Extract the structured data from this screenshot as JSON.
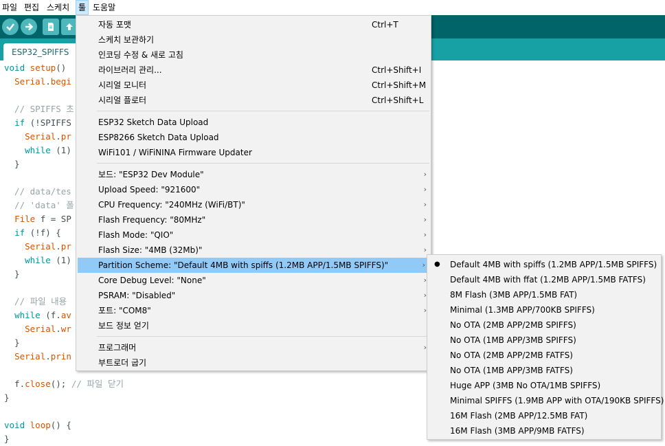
{
  "menubar": {
    "items": [
      {
        "label": "파일"
      },
      {
        "label": "편집"
      },
      {
        "label": "스케치"
      },
      {
        "label": "툴"
      },
      {
        "label": "도움말"
      }
    ]
  },
  "toolbar": {
    "buttons": [
      "verify-icon",
      "upload-icon",
      "new-icon",
      "open-icon"
    ],
    "accent": "#006468",
    "button_color": "#4db7bb"
  },
  "tabs": [
    {
      "label": "ESP32_SPIFFS"
    }
  ],
  "code": {
    "lines": [
      {
        "segments": [
          {
            "t": "void",
            "c": "kw"
          },
          {
            "t": " "
          },
          {
            "t": "setup",
            "c": "fn"
          },
          {
            "t": "()"
          }
        ]
      },
      {
        "segments": [
          {
            "t": "  "
          },
          {
            "t": "Serial",
            "c": "fn"
          },
          {
            "t": "."
          },
          {
            "t": "begi",
            "c": "fn"
          }
        ]
      },
      {
        "segments": []
      },
      {
        "segments": [
          {
            "t": "  // SPIFFS 초",
            "c": "cm"
          }
        ]
      },
      {
        "segments": [
          {
            "t": "  "
          },
          {
            "t": "if",
            "c": "kw"
          },
          {
            "t": " (!SPIFFS"
          }
        ]
      },
      {
        "segments": [
          {
            "t": "    "
          },
          {
            "t": "Serial",
            "c": "fn"
          },
          {
            "t": "."
          },
          {
            "t": "pr",
            "c": "fn"
          }
        ]
      },
      {
        "segments": [
          {
            "t": "    "
          },
          {
            "t": "while",
            "c": "kw"
          },
          {
            "t": " (1)"
          }
        ]
      },
      {
        "segments": [
          {
            "t": "  }"
          }
        ]
      },
      {
        "segments": []
      },
      {
        "segments": [
          {
            "t": "  // data/tes",
            "c": "cm"
          }
        ]
      },
      {
        "segments": [
          {
            "t": "  // 'data' 폴",
            "c": "cm"
          }
        ]
      },
      {
        "segments": [
          {
            "t": "  "
          },
          {
            "t": "File",
            "c": "fn"
          },
          {
            "t": " f = SP"
          }
        ]
      },
      {
        "segments": [
          {
            "t": "  "
          },
          {
            "t": "if",
            "c": "kw"
          },
          {
            "t": " (!f) {"
          }
        ]
      },
      {
        "segments": [
          {
            "t": "    "
          },
          {
            "t": "Serial",
            "c": "fn"
          },
          {
            "t": "."
          },
          {
            "t": "pr",
            "c": "fn"
          }
        ]
      },
      {
        "segments": [
          {
            "t": "    "
          },
          {
            "t": "while",
            "c": "kw"
          },
          {
            "t": " (1)"
          }
        ]
      },
      {
        "segments": [
          {
            "t": "  }"
          }
        ]
      },
      {
        "segments": []
      },
      {
        "segments": [
          {
            "t": "  // 파일 내용",
            "c": "cm"
          }
        ]
      },
      {
        "segments": [
          {
            "t": "  "
          },
          {
            "t": "while",
            "c": "kw"
          },
          {
            "t": " (f."
          },
          {
            "t": "av",
            "c": "fn"
          }
        ]
      },
      {
        "segments": [
          {
            "t": "    "
          },
          {
            "t": "Serial",
            "c": "fn"
          },
          {
            "t": "."
          },
          {
            "t": "wr",
            "c": "fn"
          }
        ]
      },
      {
        "segments": [
          {
            "t": "  }"
          }
        ]
      },
      {
        "segments": [
          {
            "t": "  "
          },
          {
            "t": "Serial",
            "c": "fn"
          },
          {
            "t": "."
          },
          {
            "t": "prin",
            "c": "fn"
          }
        ]
      },
      {
        "segments": []
      },
      {
        "segments": [
          {
            "t": "  f."
          },
          {
            "t": "close",
            "c": "fn"
          },
          {
            "t": "(); "
          },
          {
            "t": "// 파일 닫기",
            "c": "cm"
          }
        ]
      },
      {
        "segments": [
          {
            "t": "}"
          }
        ]
      },
      {
        "segments": []
      },
      {
        "segments": [
          {
            "t": "void",
            "c": "kw"
          },
          {
            "t": " "
          },
          {
            "t": "loop",
            "c": "fn"
          },
          {
            "t": "() {"
          }
        ]
      },
      {
        "segments": [
          {
            "t": "}"
          }
        ]
      }
    ]
  },
  "tools_menu": {
    "groups": [
      [
        {
          "label": "자동 포맷",
          "shortcut": "Ctrl+T"
        },
        {
          "label": "스케치 보관하기",
          "shortcut": ""
        },
        {
          "label": "인코딩 수정 & 새로 고침",
          "shortcut": ""
        },
        {
          "label": "라이브러리 관리...",
          "shortcut": "Ctrl+Shift+I"
        },
        {
          "label": "시리얼 모니터",
          "shortcut": "Ctrl+Shift+M"
        },
        {
          "label": "시리얼 플로터",
          "shortcut": "Ctrl+Shift+L"
        }
      ],
      [
        {
          "label": "ESP32 Sketch Data Upload",
          "shortcut": ""
        },
        {
          "label": "ESP8266 Sketch Data Upload",
          "shortcut": ""
        },
        {
          "label": "WiFi101 / WiFiNINA Firmware Updater",
          "shortcut": ""
        }
      ],
      [
        {
          "label": "보드: \"ESP32 Dev Module\"",
          "submenu": true
        },
        {
          "label": "Upload Speed: \"921600\"",
          "submenu": true
        },
        {
          "label": "CPU Frequency: \"240MHz (WiFi/BT)\"",
          "submenu": true
        },
        {
          "label": "Flash Frequency: \"80MHz\"",
          "submenu": true
        },
        {
          "label": "Flash Mode: \"QIO\"",
          "submenu": true
        },
        {
          "label": "Flash Size: \"4MB (32Mb)\"",
          "submenu": true
        },
        {
          "label": "Partition Scheme: \"Default 4MB with spiffs (1.2MB APP/1.5MB SPIFFS)\"",
          "submenu": true,
          "highlighted": true
        },
        {
          "label": "Core Debug Level: \"None\"",
          "submenu": true
        },
        {
          "label": "PSRAM: \"Disabled\"",
          "submenu": true
        },
        {
          "label": "포트: \"COM8\"",
          "submenu": true
        },
        {
          "label": "보드 정보 얻기",
          "submenu": false
        }
      ],
      [
        {
          "label": "프로그래머",
          "submenu": true
        },
        {
          "label": "부트로더 굽기",
          "submenu": false
        }
      ]
    ]
  },
  "partition_submenu": {
    "items": [
      {
        "label": "Default 4MB with spiffs (1.2MB APP/1.5MB SPIFFS)",
        "selected": true
      },
      {
        "label": "Default 4MB with ffat (1.2MB APP/1.5MB FATFS)"
      },
      {
        "label": "8M Flash (3MB APP/1.5MB FAT)"
      },
      {
        "label": "Minimal (1.3MB APP/700KB SPIFFS)"
      },
      {
        "label": "No OTA (2MB APP/2MB SPIFFS)"
      },
      {
        "label": "No OTA (1MB APP/3MB SPIFFS)"
      },
      {
        "label": "No OTA (2MB APP/2MB FATFS)"
      },
      {
        "label": "No OTA (1MB APP/3MB FATFS)"
      },
      {
        "label": "Huge APP (3MB No OTA/1MB SPIFFS)"
      },
      {
        "label": "Minimal SPIFFS (1.9MB APP with OTA/190KB SPIFFS)"
      },
      {
        "label": "16M Flash (2MB APP/12.5MB FAT)"
      },
      {
        "label": "16M Flash (3MB APP/9MB FATFS)"
      }
    ],
    "selected_bullet": "●"
  },
  "colors": {
    "menu_highlight": "#91c9f7",
    "tab_bar": "#17a1a5",
    "keyword": "#00979d",
    "function": "#d35400",
    "comment": "#95a5a6"
  }
}
